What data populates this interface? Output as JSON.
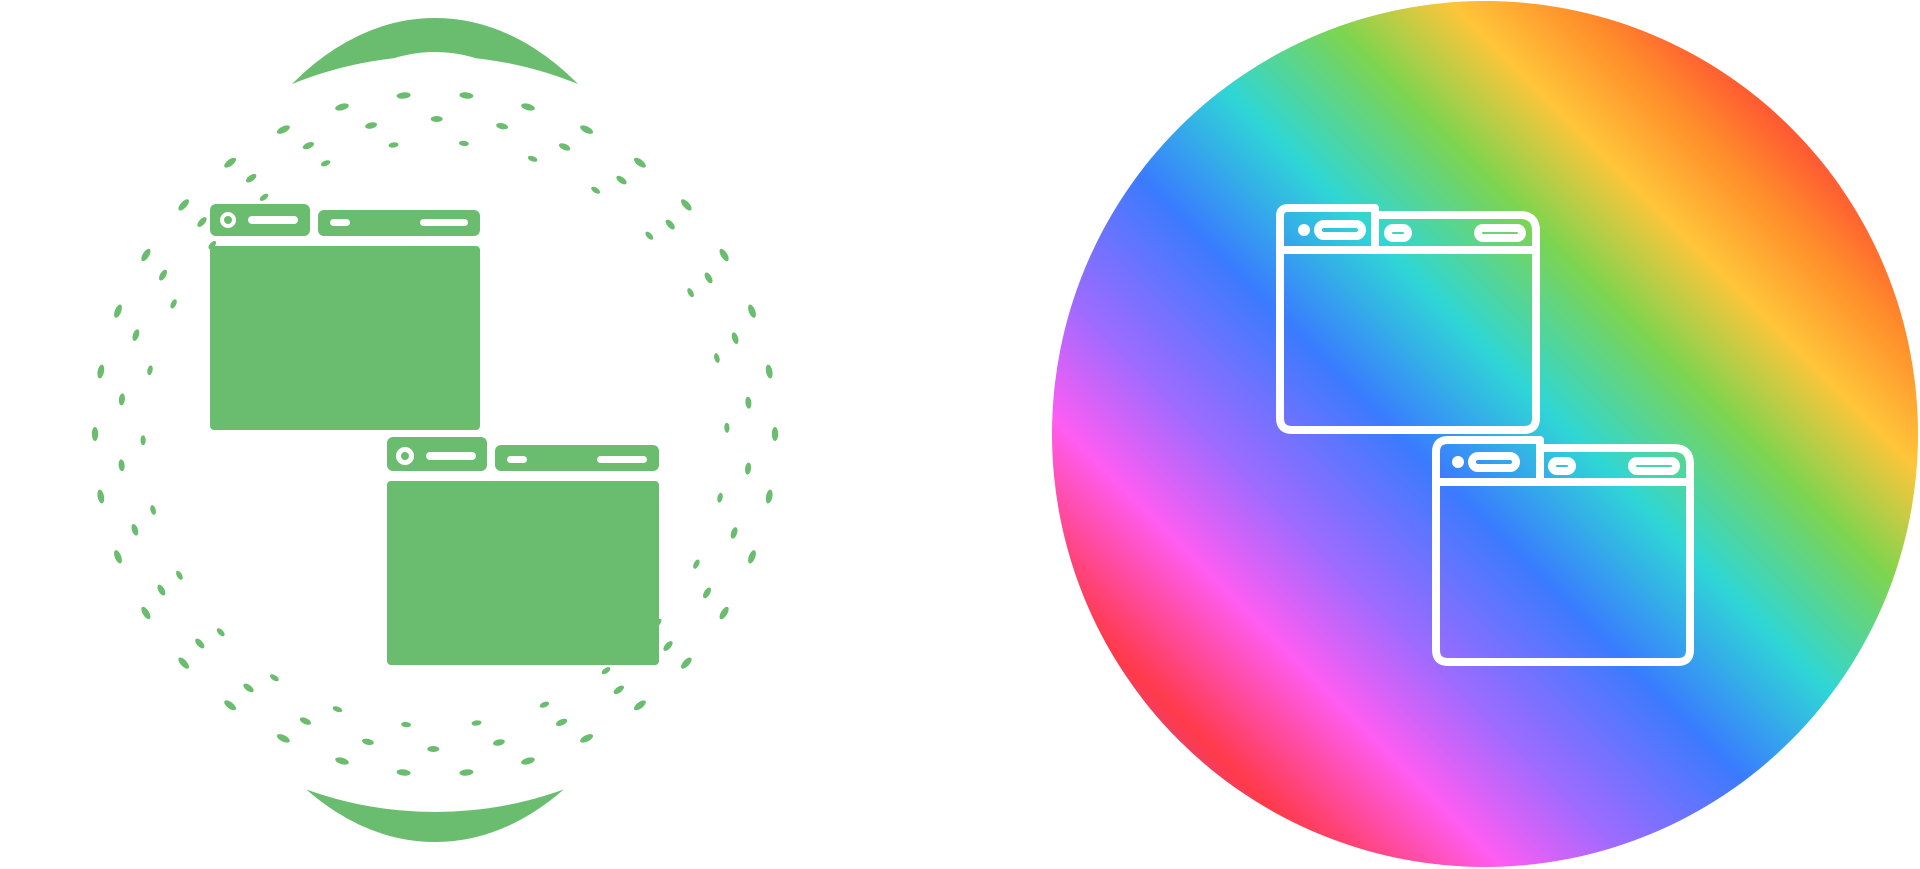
{
  "icons": [
    {
      "name": "windows-icon-green-badge",
      "style": "glyph",
      "colors": {
        "fill": "#6abd6e",
        "background": "#ffffff"
      }
    },
    {
      "name": "windows-icon-gradient-circle",
      "style": "outline",
      "colors": {
        "stroke": "#ffffff",
        "gradient": [
          "#ffffff",
          "#ff2a3a",
          "#ff8c2a",
          "#ffd23a",
          "#7ed44f",
          "#2fd6d6",
          "#3a7bff",
          "#9d6bff",
          "#ff5cf2",
          "#ff3a4a",
          "#2fd6d6"
        ]
      }
    }
  ]
}
